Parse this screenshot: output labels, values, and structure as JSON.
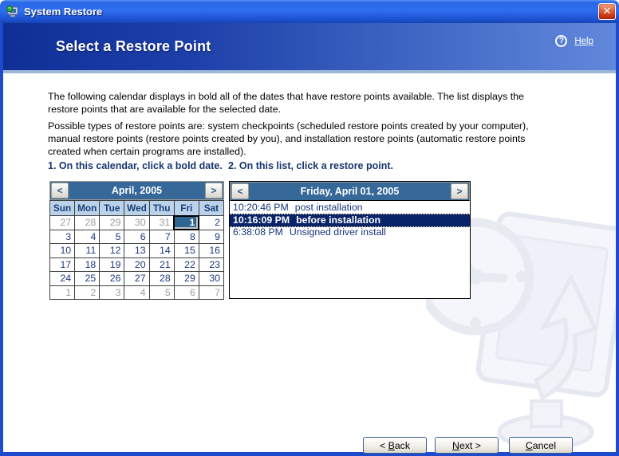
{
  "titlebar": {
    "title": "System Restore"
  },
  "icons": {
    "close": "✕",
    "help": "?",
    "prev": "<",
    "next": ">"
  },
  "header": {
    "title": "Select a Restore Point",
    "help_label": "Help"
  },
  "intro": {
    "p1": [
      "The following calendar displays in bold all of the dates that have restore points available. The list displays the",
      "restore points that are available for the selected date."
    ],
    "p2": [
      "Possible types of restore points are: system checkpoints (scheduled restore points created by your computer),",
      "manual restore points (restore points created by you), and installation restore points (automatic restore points",
      "created when certain programs are installed)."
    ]
  },
  "steps": {
    "calendar_instruction": "1. On this calendar, click a bold date.",
    "list_instruction": "2. On this list, click a restore point."
  },
  "calendar": {
    "month_label": "April, 2005",
    "day_headers": [
      "Sun",
      "Mon",
      "Tue",
      "Wed",
      "Thu",
      "Fri",
      "Sat"
    ],
    "weeks": [
      [
        {
          "d": "27",
          "muted": true
        },
        {
          "d": "28",
          "muted": true
        },
        {
          "d": "29",
          "muted": true
        },
        {
          "d": "30",
          "muted": true
        },
        {
          "d": "31",
          "muted": true
        },
        {
          "d": "1",
          "selected": true,
          "bold": true
        },
        {
          "d": "2"
        }
      ],
      [
        {
          "d": "3"
        },
        {
          "d": "4"
        },
        {
          "d": "5"
        },
        {
          "d": "6"
        },
        {
          "d": "7"
        },
        {
          "d": "8"
        },
        {
          "d": "9"
        }
      ],
      [
        {
          "d": "10"
        },
        {
          "d": "11"
        },
        {
          "d": "12"
        },
        {
          "d": "13"
        },
        {
          "d": "14"
        },
        {
          "d": "15"
        },
        {
          "d": "16"
        }
      ],
      [
        {
          "d": "17"
        },
        {
          "d": "18"
        },
        {
          "d": "19"
        },
        {
          "d": "20"
        },
        {
          "d": "21"
        },
        {
          "d": "22"
        },
        {
          "d": "23"
        }
      ],
      [
        {
          "d": "24"
        },
        {
          "d": "25"
        },
        {
          "d": "26"
        },
        {
          "d": "27"
        },
        {
          "d": "28"
        },
        {
          "d": "29"
        },
        {
          "d": "30"
        }
      ],
      [
        {
          "d": "1",
          "muted": true
        },
        {
          "d": "2",
          "muted": true
        },
        {
          "d": "3",
          "muted": true
        },
        {
          "d": "4",
          "muted": true
        },
        {
          "d": "5",
          "muted": true
        },
        {
          "d": "6",
          "muted": true
        },
        {
          "d": "7",
          "muted": true
        }
      ]
    ]
  },
  "restore_list": {
    "date_label": "Friday, April 01, 2005",
    "items": [
      {
        "time": "10:20:46 PM",
        "label": "post installation",
        "selected": false
      },
      {
        "time": "10:16:09 PM",
        "label": "before installation",
        "selected": true
      },
      {
        "time": "6:38:08 PM",
        "label": "Unsigned driver install",
        "selected": false
      }
    ]
  },
  "buttons": {
    "back": {
      "pre": "< ",
      "key": "B",
      "rest": "ack"
    },
    "next": {
      "key": "N",
      "rest": "ext >"
    },
    "cancel": {
      "key": "C",
      "rest": "ancel"
    }
  },
  "colors": {
    "titlebar_blue": "#2A66E4",
    "window_border": "#1E4ACD",
    "header_gradient_left": "#0F2F96",
    "header_gradient_right": "#6288DC",
    "band_steel_blue": "#36689A",
    "day_header_bg": "#BAD2EA",
    "date_text_navy": "#1A3A7E",
    "selected_date_bg": "#2F6591",
    "list_selection_navy": "#0A246A",
    "close_button_red": "#CC3915",
    "step_heading_navy": "#17356F"
  }
}
